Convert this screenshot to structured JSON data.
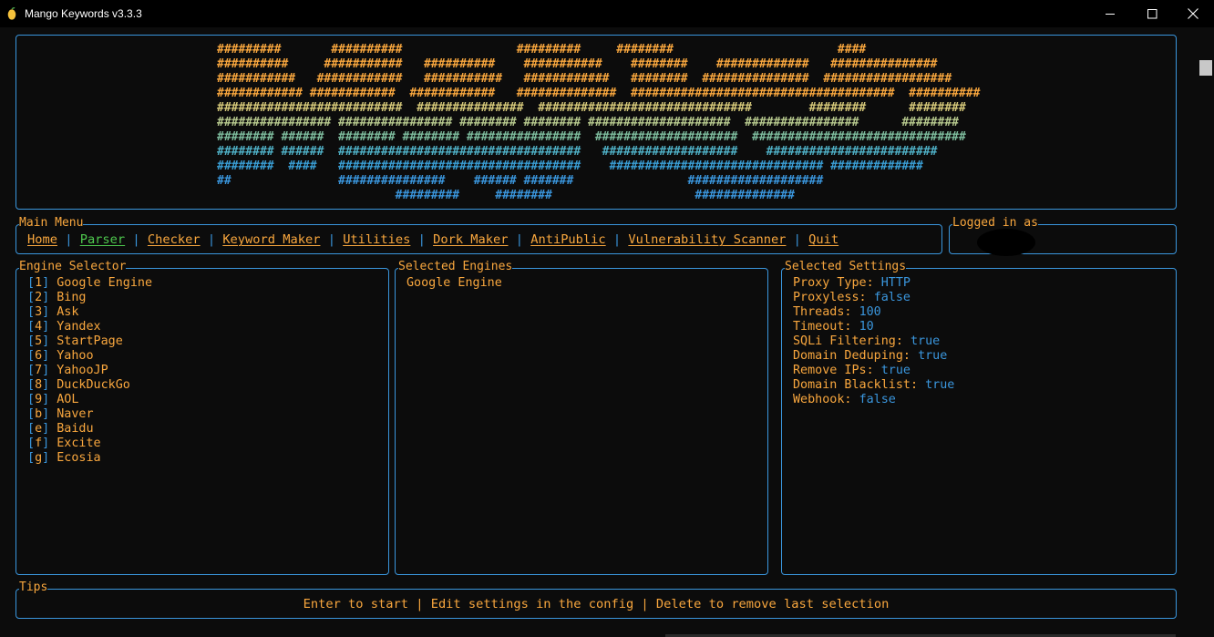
{
  "window": {
    "title": "Mango Keywords v3.3.3",
    "controls": {
      "minimize": "—",
      "maximize": "☐",
      "close": "✕"
    }
  },
  "banner": {
    "lines": [
      {
        "text": "#########       ##########                #########     ########                       ####",
        "color": "#f9a73e"
      },
      {
        "text": "##########     ###########   ##########    ###########    ########    #############   ###############",
        "color": "#f9a73e"
      },
      {
        "text": "###########   ############   ###########   ############   ########  ###############  ##################",
        "color": "#f9a73e"
      },
      {
        "text": "############ ############  ############   ##############  #####################################  ##########",
        "color": "#f9a73e"
      },
      {
        "text": "##########################  ###############  ##############################        ########      ########",
        "color": "#d6c97a"
      },
      {
        "text": "################ ################ ######## ######## ####################  ################      ########",
        "color": "#b7c98e"
      },
      {
        "text": "######## ######  ######## ######## ################  ####################  ##############################",
        "color": "#7ebd9e"
      },
      {
        "text": "######## ######  ##################################   ###################    ########################",
        "color": "#4fb0c6"
      },
      {
        "text": "########  ####   ##################################    ############################## #############",
        "color": "#3a9fd6"
      },
      {
        "text": "##               ###############    ###### #######                ###################",
        "color": "#3a96dd"
      },
      {
        "text": "                         #########     ########                    ##############",
        "color": "#3a96dd"
      }
    ]
  },
  "menu": {
    "title": "Main Menu",
    "items": [
      {
        "label": "Home",
        "active": false
      },
      {
        "label": "Parser",
        "active": true
      },
      {
        "label": "Checker",
        "active": false
      },
      {
        "label": "Keyword Maker",
        "active": false
      },
      {
        "label": "Utilities",
        "active": false
      },
      {
        "label": "Dork Maker",
        "active": false
      },
      {
        "label": "AntiPublic",
        "active": false
      },
      {
        "label": "Vulnerability Scanner",
        "active": false
      },
      {
        "label": "Quit",
        "active": false
      }
    ],
    "separator": " | "
  },
  "login": {
    "title": "Logged in as"
  },
  "engine_selector": {
    "title": "Engine Selector",
    "items": [
      {
        "key": "1",
        "name": "Google Engine"
      },
      {
        "key": "2",
        "name": "Bing"
      },
      {
        "key": "3",
        "name": "Ask"
      },
      {
        "key": "4",
        "name": "Yandex"
      },
      {
        "key": "5",
        "name": "StartPage"
      },
      {
        "key": "6",
        "name": "Yahoo"
      },
      {
        "key": "7",
        "name": "YahooJP"
      },
      {
        "key": "8",
        "name": "DuckDuckGo"
      },
      {
        "key": "9",
        "name": "AOL"
      },
      {
        "key": "b",
        "name": "Naver"
      },
      {
        "key": "e",
        "name": "Baidu"
      },
      {
        "key": "f",
        "name": "Excite"
      },
      {
        "key": "g",
        "name": "Ecosia"
      }
    ]
  },
  "selected_engines": {
    "title": "Selected Engines",
    "items": [
      "Google Engine"
    ]
  },
  "selected_settings": {
    "title": "Selected Settings",
    "items": [
      {
        "label": "Proxy Type:",
        "value": "HTTP"
      },
      {
        "label": "Proxyless:",
        "value": "false"
      },
      {
        "label": "Threads:",
        "value": "100"
      },
      {
        "label": "Timeout:",
        "value": "10"
      },
      {
        "label": "SQLi Filtering:",
        "value": "true"
      },
      {
        "label": "Domain Deduping:",
        "value": "true"
      },
      {
        "label": "Remove IPs:",
        "value": "true"
      },
      {
        "label": "Domain Blacklist:",
        "value": "true"
      },
      {
        "label": "Webhook:",
        "value": "false"
      }
    ]
  },
  "tips": {
    "title": "Tips",
    "text": "Enter to start | Edit settings in the config | Delete to remove last selection"
  },
  "colors": {
    "background": "#0c0c0c",
    "accent_orange": "#f9a73e",
    "accent_blue": "#3a96dd",
    "active_green": "#4ec94e"
  }
}
